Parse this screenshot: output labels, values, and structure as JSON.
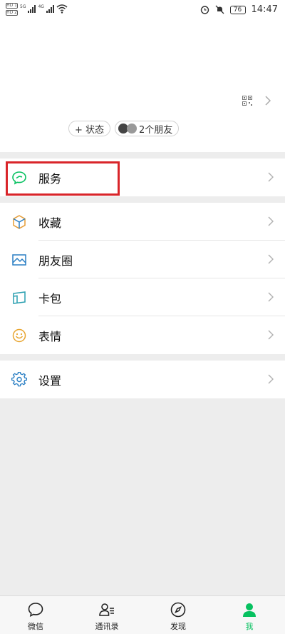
{
  "status_bar": {
    "sim_badges": [
      "HD 1",
      "HD 2"
    ],
    "network_labels": [
      "5G",
      "4G"
    ],
    "battery": "76",
    "time": "14:47",
    "icons": [
      "wifi-icon",
      "alarm-icon",
      "mute-icon"
    ]
  },
  "profile": {
    "status_pill": "+ 状态",
    "friends_pill": "2个朋友",
    "icons": [
      "qr-code-icon",
      "chevron-right-icon"
    ]
  },
  "menu": {
    "service": "服务",
    "favorites": "收藏",
    "moments": "朋友圈",
    "wallet": "卡包",
    "stickers": "表情",
    "settings": "设置"
  },
  "tabbar": {
    "tabs": [
      {
        "label": "微信",
        "icon": "chat-bubble-icon",
        "active": false
      },
      {
        "label": "通讯录",
        "icon": "contacts-icon",
        "active": false
      },
      {
        "label": "发现",
        "icon": "compass-icon",
        "active": false
      },
      {
        "label": "我",
        "icon": "person-icon",
        "active": true
      }
    ]
  },
  "colors": {
    "accent_green": "#07c160",
    "highlight_red": "#d9252a",
    "background": "#ededed"
  }
}
